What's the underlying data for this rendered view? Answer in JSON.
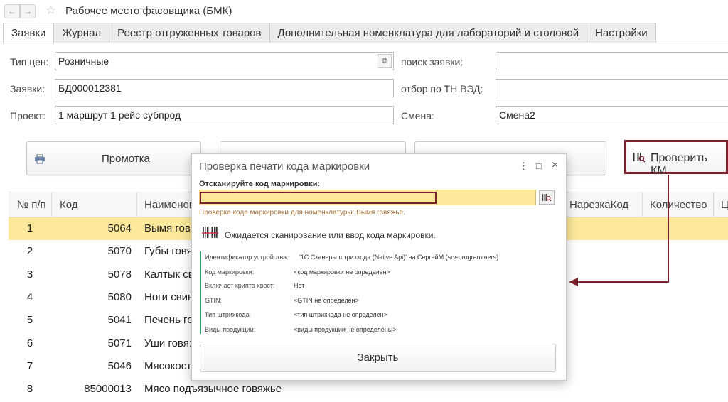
{
  "window": {
    "title": "Рабочее место фасовщика (БМК)",
    "back": "←",
    "forward": "→",
    "favorite": "☆"
  },
  "tabs": [
    {
      "label": "Заявки"
    },
    {
      "label": "Журнал"
    },
    {
      "label": "Реестр отгруженных товаров"
    },
    {
      "label": "Дополнительная номенклатура для лабораторий и столовой"
    },
    {
      "label": "Настройки"
    }
  ],
  "form": {
    "price_type_label": "Тип цен:",
    "price_type_value": "Розничные",
    "orders_label": "Заявки:",
    "orders_value": "БД000012381",
    "project_label": "Проект:",
    "project_value": "1 маршрут 1 рейс субпрод",
    "search_label": "поиск заявки:",
    "search_value": "",
    "tnved_label": "отбор по ТН ВЭД:",
    "tnved_value": "",
    "shift_label": "Смена:",
    "shift_value": "Смена2"
  },
  "toolbar": {
    "promotka_label": "Промотка",
    "check_km_label": "Проверить КМ"
  },
  "grid": {
    "columns": [
      "№ п/п",
      "Код",
      "Наименов",
      "НарезкаКод",
      "Количество",
      "Ц"
    ],
    "rows": [
      {
        "num": "1",
        "code": "5064",
        "name": "Вымя говя"
      },
      {
        "num": "2",
        "code": "5070",
        "name": "Губы говя"
      },
      {
        "num": "3",
        "code": "5078",
        "name": "Калтык св"
      },
      {
        "num": "4",
        "code": "5080",
        "name": "Ноги свин"
      },
      {
        "num": "5",
        "code": "5041",
        "name": "Печень го"
      },
      {
        "num": "6",
        "code": "5071",
        "name": "Уши говя:"
      },
      {
        "num": "7",
        "code": "5046",
        "name": "Мясокост"
      },
      {
        "num": "8",
        "code": "85000013",
        "name": "Мясо подъязычное говяжье"
      }
    ]
  },
  "dialog": {
    "title": "Проверка печати кода маркировки",
    "menu": "⋮",
    "maximize": "□",
    "close": "×",
    "scan_prompt": "Отсканируйте код маркировки:",
    "input_value": "",
    "note": "Проверка кода маркировки для номенклатуры: Вымя говяжье.",
    "waiting": "Ожидается сканирование или ввод кода маркировки.",
    "info": [
      {
        "label": "Идентификатор устройства:",
        "value": "'1С:Сканеры штрихкода (Native Api)' на СергейМ (srv-programmers)"
      },
      {
        "label": "Код маркировки:",
        "value": "<код маркировки не определен>"
      },
      {
        "label": "Включает крипто хвост:",
        "value": "Нет"
      },
      {
        "label": "GTIN:",
        "value": "<GTIN не определен>"
      },
      {
        "label": "Тип штрихкода:",
        "value": "<тип штрихкода не определен>"
      },
      {
        "label": "Виды продукции:",
        "value": "<виды продукции не определены>"
      }
    ],
    "close_button": "Закрыть"
  },
  "colors": {
    "accent_dark_red": "#7a1f2b",
    "selected_row": "#fbe89a",
    "info_bar": "#2e9e6a"
  }
}
